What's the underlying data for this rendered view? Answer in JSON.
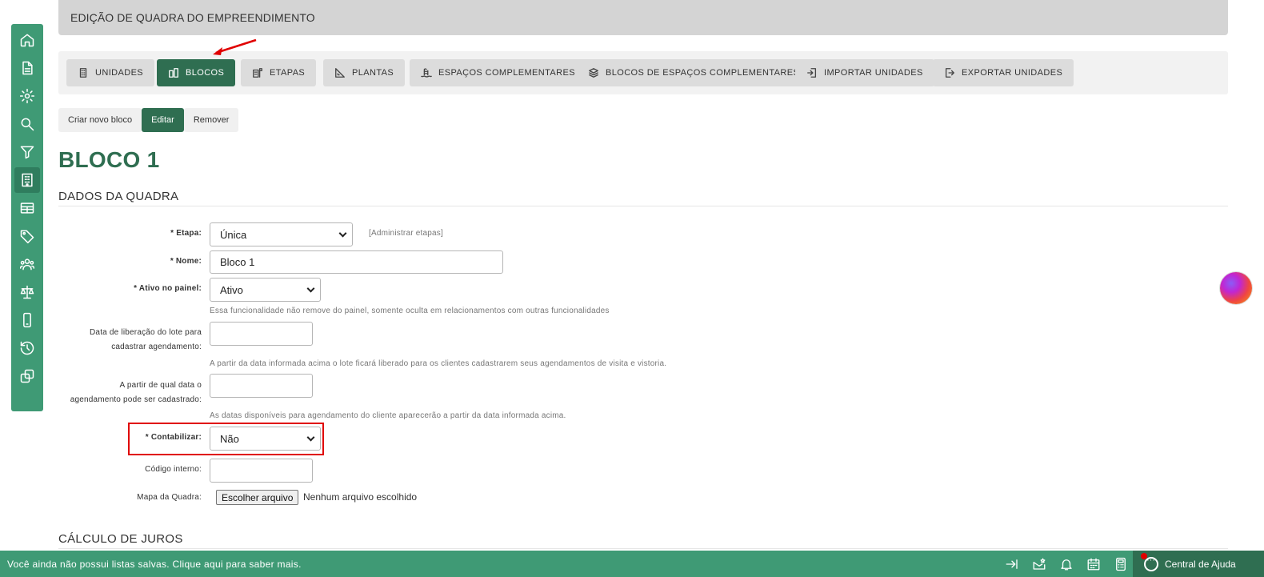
{
  "header": {
    "title": "EDIÇÃO DE QUADRA DO EMPREENDIMENTO"
  },
  "sidebar": {
    "items": [
      {
        "icon": "home-icon"
      },
      {
        "icon": "document-icon"
      },
      {
        "icon": "gear-icon"
      },
      {
        "icon": "search-icon"
      },
      {
        "icon": "filter-icon"
      },
      {
        "icon": "building-icon",
        "active": true
      },
      {
        "icon": "table-icon"
      },
      {
        "icon": "tag-icon"
      },
      {
        "icon": "users-icon"
      },
      {
        "icon": "scale-icon"
      },
      {
        "icon": "mobile-icon"
      },
      {
        "icon": "history-icon"
      },
      {
        "icon": "copy-icon"
      }
    ]
  },
  "tabs": [
    {
      "label": "UNIDADES",
      "icon": "building-icon"
    },
    {
      "label": "BLOCOS",
      "icon": "blocks-icon",
      "active": true
    },
    {
      "label": "ETAPAS",
      "icon": "flag-building-icon"
    },
    {
      "label": "PLANTAS",
      "icon": "ruler-icon"
    },
    {
      "label": "ESPAÇOS COMPLEMENTARES",
      "icon": "pool-icon"
    },
    {
      "label": "BLOCOS DE ESPAÇOS COMPLEMENTARES",
      "icon": "layers-icon"
    },
    {
      "label": "IMPORTAR UNIDADES",
      "icon": "import-icon"
    },
    {
      "label": "EXPORTAR UNIDADES",
      "icon": "export-icon"
    }
  ],
  "actions": {
    "create": "Criar novo bloco",
    "edit": "Editar",
    "remove": "Remover"
  },
  "page_title": "BLOCO 1",
  "section_data": "DADOS DA QUADRA",
  "section_interest": "CÁLCULO DE JUROS",
  "form": {
    "etapa": {
      "label": "* Etapa:",
      "value": "Única",
      "link": "[Administrar etapas]"
    },
    "nome": {
      "label": "* Nome:",
      "value": "Bloco 1"
    },
    "ativo": {
      "label": "* Ativo no painel:",
      "value": "Ativo",
      "hint": "Essa funcionalidade não remove do painel, somente oculta em relacionamentos com outras funcionalidades"
    },
    "liberacao": {
      "label_line1": "Data de liberação do lote para",
      "label_line2": "cadastrar agendamento:",
      "value": "",
      "hint": "A partir da data informada acima o lote ficará liberado para os clientes cadastrarem seus agendamentos de visita e vistoria."
    },
    "agendamento": {
      "label_line1": "A partir de qual data o",
      "label_line2": "agendamento pode ser cadastrado:",
      "value": "",
      "hint": "As datas disponíveis para agendamento do cliente aparecerão a partir da data informada acima."
    },
    "contabilizar": {
      "label": "* Contabilizar:",
      "value": "Não"
    },
    "codigo": {
      "label": "Código interno:",
      "value": ""
    },
    "mapa": {
      "label": "Mapa da Quadra:",
      "button": "Escolher arquivo",
      "status": "Nenhum arquivo escolhido"
    }
  },
  "footer": {
    "message": "Você ainda não possui listas salvas. Clique aqui para saber mais.",
    "icons": [
      "collapse-right-icon",
      "mail-star-icon",
      "bell-icon",
      "calendar-icon",
      "calculator-icon"
    ],
    "help_label": "Central de Ajuda"
  },
  "colors": {
    "primary": "#3f9a75",
    "dark_green": "#2f6e51",
    "highlight_red": "#e00000"
  }
}
